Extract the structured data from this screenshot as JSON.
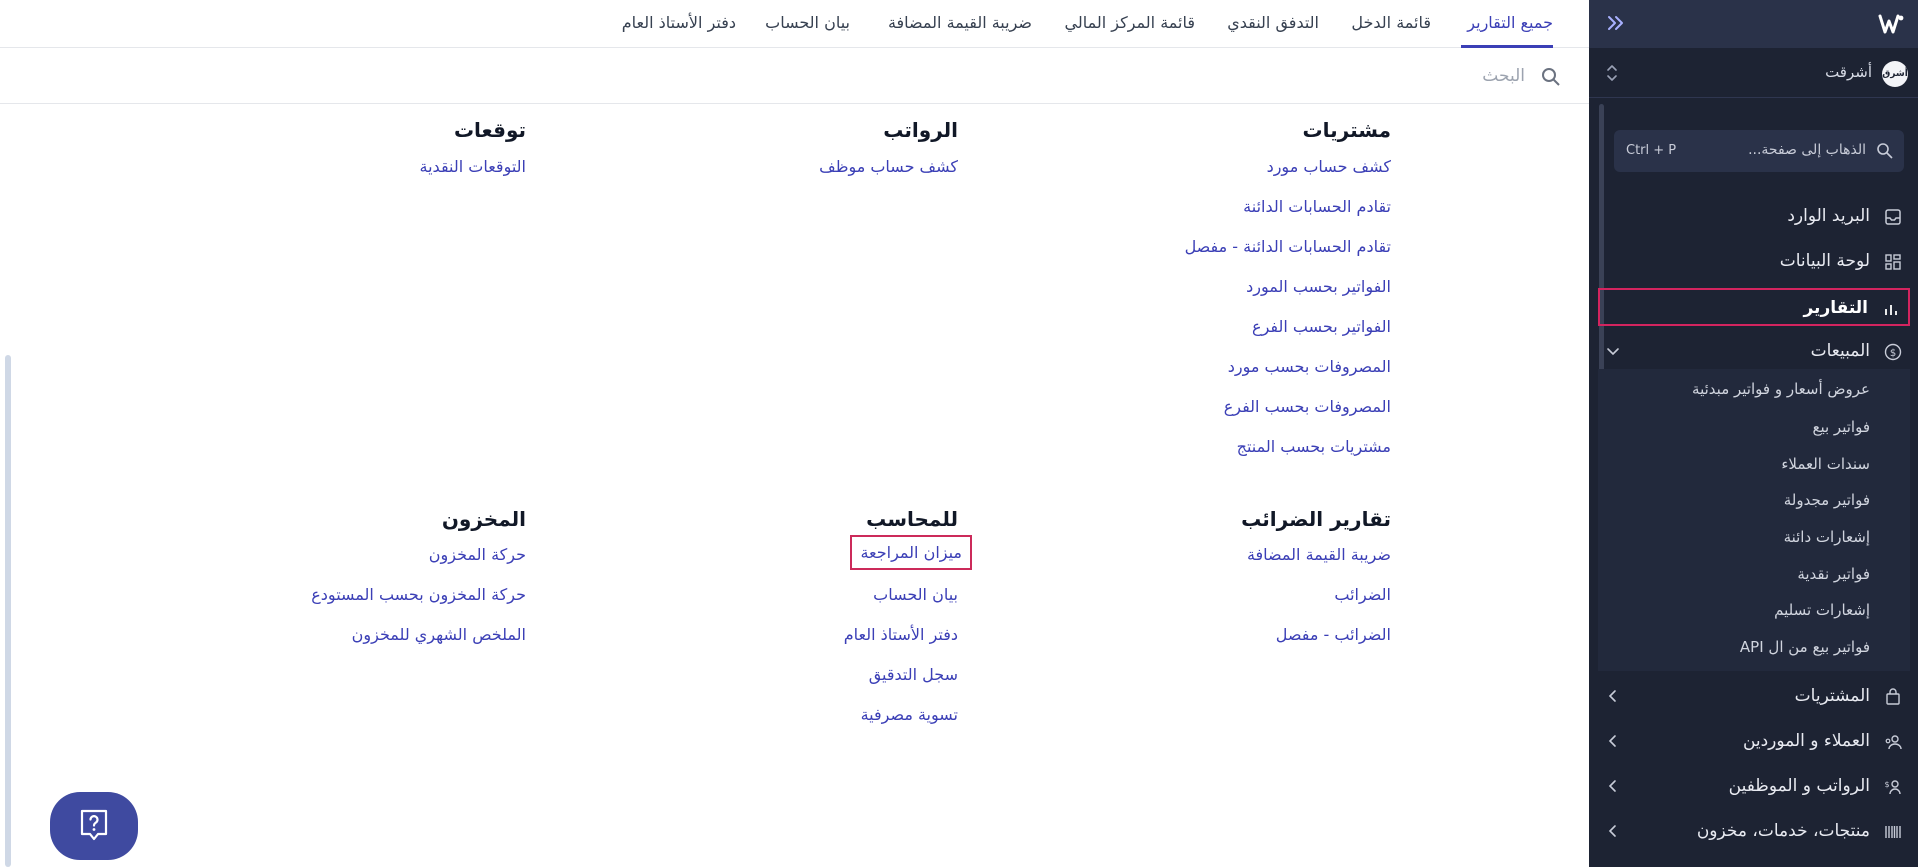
{
  "tabs": [
    "جميع التقارير",
    "قائمة الدخل",
    "التدفق النقدي",
    "قائمة المركز المالي",
    "ضريبة القيمة المضافة",
    "بيان الحساب",
    "دفتر الأستاذ العام"
  ],
  "search": {
    "placeholder": "البحث"
  },
  "sections": {
    "purchases": {
      "title": "مشتريات",
      "links": [
        "كشف حساب مورد",
        "تقادم الحسابات الدائنة",
        "تقادم الحسابات الدائنة - مفصل",
        "الفواتير بحسب المورد",
        "الفواتير بحسب الفرع",
        "المصروفات بحسب مورد",
        "المصروفات بحسب الفرع",
        "مشتريات بحسب المنتج"
      ]
    },
    "payroll": {
      "title": "الرواتب",
      "links": [
        "كشف حساب موظف"
      ]
    },
    "forecasts": {
      "title": "توقعات",
      "links": [
        "التوقعات النقدية"
      ]
    },
    "tax": {
      "title": "تقارير الضرائب",
      "links": [
        "ضريبة القيمة المضافة",
        "الضرائب",
        "الضرائب - مفصل"
      ]
    },
    "accountant": {
      "title": "للمحاسب",
      "links": [
        "ميزان المراجعة",
        "بيان الحساب",
        "دفتر الأستاذ العام",
        "سجل التدقيق",
        "تسوية مصرفية"
      ]
    },
    "inventory": {
      "title": "المخزون",
      "links": [
        "حركة المخزون",
        "حركة المخزون بحسب المستودع",
        "الملخص الشهري للمخزون"
      ]
    }
  },
  "sidebar": {
    "org_name": "أشرقت",
    "org_avatar": "أشرق",
    "goto_placeholder": "الذهاب إلى صفحة...",
    "goto_shortcut": "Ctrl + P",
    "items": [
      "البريد الوارد",
      "لوحة البيانات",
      "التقارير",
      "المبيعات",
      "المشتريات",
      "العملاء و الموردين",
      "الرواتب و الموظفين",
      "منتجات، خدمات، مخزون"
    ],
    "sales_sub": [
      "عروض أسعار و فواتير مبدئية",
      "فواتير بيع",
      "سندات العملاء",
      "فواتير مجدولة",
      "إشعارات دائنة",
      "فواتير نقدية",
      "إشعارات تسليم",
      "فواتير بيع من ال API"
    ]
  },
  "colors": {
    "accent": "#3b3fb6",
    "sidebar_bg": "#1d2333",
    "highlight": "#cc2a5a"
  }
}
